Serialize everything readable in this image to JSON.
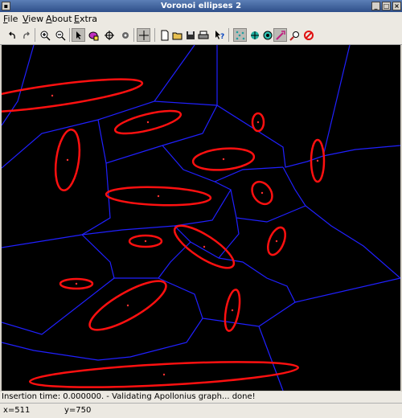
{
  "window": {
    "title": "Voronoi ellipses 2"
  },
  "menubar": {
    "items": [
      {
        "accel": "F",
        "rest": "ile"
      },
      {
        "accel": "V",
        "rest": "iew"
      },
      {
        "accel": "A",
        "rest": "bout"
      },
      {
        "accel": "E",
        "rest": "xtra"
      }
    ]
  },
  "toolbar": {
    "tools": [
      "undo-icon",
      "redo-icon",
      "zoom-in-icon",
      "zoom-out-icon",
      "pointer-icon",
      "ellipse-select-icon",
      "crosshair-center-icon",
      "settings-icon",
      "insert-point-icon",
      "new-file-icon",
      "open-file-icon",
      "save-icon",
      "print-icon",
      "whats-this-icon",
      "voronoi-points-icon",
      "voronoi-ellipse-icon",
      "apollonius-icon",
      "delete-pointer-icon",
      "search-icon",
      "clear-icon"
    ]
  },
  "status": {
    "message": "Insertion time: 0.000000. - Validating Apollonius graph... done!"
  },
  "coords": {
    "x": "x=511",
    "y": "y=750"
  },
  "colors": {
    "edges": "#2020ff",
    "ellipses": "#ff1010",
    "background": "#000000"
  }
}
